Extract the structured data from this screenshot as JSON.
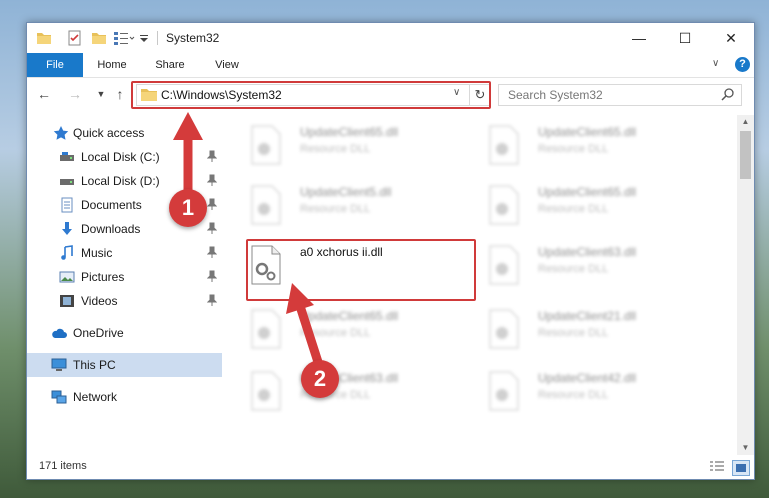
{
  "window": {
    "title": "System32"
  },
  "window_controls": {
    "minimize": "—",
    "maximize": "☐",
    "close": "✕"
  },
  "ribbon": {
    "tabs": [
      {
        "label": "File"
      },
      {
        "label": "Home"
      },
      {
        "label": "Share"
      },
      {
        "label": "View"
      }
    ],
    "help": "?"
  },
  "address_bar": {
    "path": "C:\\Windows\\System32"
  },
  "search": {
    "placeholder": "Search System32"
  },
  "sidebar": {
    "items": [
      {
        "label": "Quick access",
        "icon": "star-icon"
      },
      {
        "label": "Local Disk (C:)",
        "icon": "drive-icon",
        "pinned": true
      },
      {
        "label": "Local Disk (D:)",
        "icon": "drive-icon",
        "pinned": true
      },
      {
        "label": "Documents",
        "icon": "documents-icon",
        "pinned": true
      },
      {
        "label": "Downloads",
        "icon": "downloads-icon",
        "pinned": true
      },
      {
        "label": "Music",
        "icon": "music-icon",
        "pinned": true
      },
      {
        "label": "Pictures",
        "icon": "pictures-icon",
        "pinned": true
      },
      {
        "label": "Videos",
        "icon": "videos-icon",
        "pinned": true
      },
      {
        "label": "OneDrive",
        "icon": "cloud-icon"
      },
      {
        "label": "This PC",
        "icon": "computer-icon",
        "selected": true
      },
      {
        "label": "Network",
        "icon": "network-icon"
      }
    ]
  },
  "files": [
    {
      "name": "UpdateClient65.dll",
      "type": "Resource DLL"
    },
    {
      "name": "UpdateClient65.dll",
      "type": "Resource DLL"
    },
    {
      "name": "UpdateClient5.dll",
      "type": "Resource DLL"
    },
    {
      "name": "UpdateClient65.dll",
      "type": "Resource DLL"
    },
    {
      "name": "a0 xchorus ii.dll",
      "type": ""
    },
    {
      "name": "UpdateClient63.dll",
      "type": "Resource DLL"
    },
    {
      "name": "UpdateClient65.dll",
      "type": "Resource DLL"
    },
    {
      "name": "UpdateClient21.dll",
      "type": "Resource DLL"
    },
    {
      "name": "UpdateClient63.dll",
      "type": "Resource DLL"
    },
    {
      "name": "UpdateClient42.dll",
      "type": "Resource DLL"
    }
  ],
  "status": {
    "item_count": "171 items"
  },
  "annotations": {
    "step1": "1",
    "step2": "2"
  },
  "colors": {
    "accent": "#1979ca",
    "highlight": "#d03a3a",
    "selection": "#ccdcf0"
  }
}
